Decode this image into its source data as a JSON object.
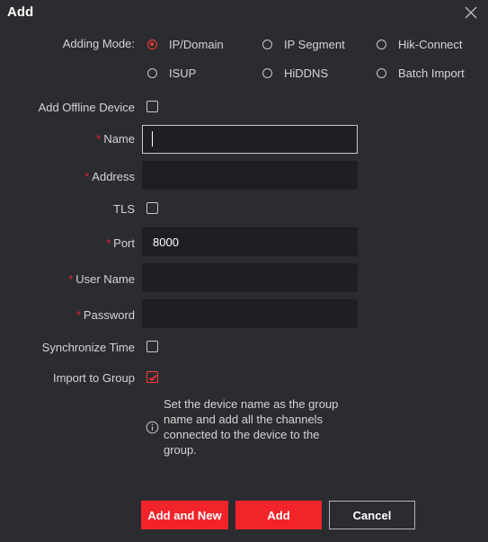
{
  "dialog": {
    "title": "Add",
    "close_icon": "close-icon"
  },
  "adding_mode": {
    "label": "Adding Mode:",
    "options": [
      {
        "label": "IP/Domain",
        "selected": true
      },
      {
        "label": "IP Segment",
        "selected": false
      },
      {
        "label": "Hik-Connect",
        "selected": false
      },
      {
        "label": "ISUP",
        "selected": false
      },
      {
        "label": "HiDDNS",
        "selected": false
      },
      {
        "label": "Batch Import",
        "selected": false
      }
    ]
  },
  "offline_device": {
    "label": "Add Offline Device",
    "checked": false
  },
  "fields": {
    "required_mark": "*",
    "name": {
      "label": "Name",
      "value": ""
    },
    "address": {
      "label": "Address",
      "value": ""
    },
    "tls": {
      "label": "TLS",
      "checked": false
    },
    "port": {
      "label": "Port",
      "value": "8000"
    },
    "username": {
      "label": "User Name",
      "value": ""
    },
    "password": {
      "label": "Password",
      "value": ""
    }
  },
  "sync_time": {
    "label": "Synchronize Time",
    "checked": false
  },
  "import_group": {
    "label": "Import to Group",
    "checked": true
  },
  "info": {
    "icon": "info-icon",
    "text": "Set the device name as the group name and add all the channels connected to the device to the group."
  },
  "buttons": {
    "add_and_new": "Add and New",
    "add": "Add",
    "cancel": "Cancel"
  },
  "colors": {
    "accent": "#f3232a",
    "background": "#2b2c30",
    "input_background": "#1e1f22"
  }
}
